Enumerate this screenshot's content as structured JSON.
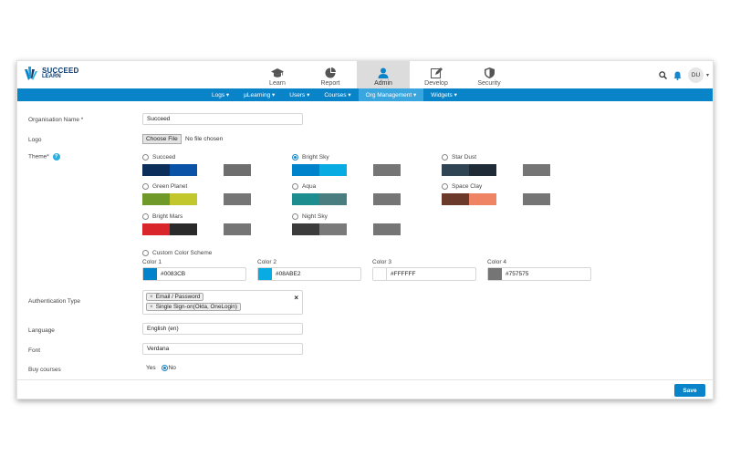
{
  "brand": {
    "line1": "SUCCEED",
    "line2": "LEARN"
  },
  "main_nav": [
    {
      "label": "Learn",
      "icon": "graduation-cap-icon",
      "active": false
    },
    {
      "label": "Report",
      "icon": "pie-chart-icon",
      "active": false
    },
    {
      "label": "Admin",
      "icon": "user-icon",
      "active": true
    },
    {
      "label": "Develop",
      "icon": "edit-icon",
      "active": false
    },
    {
      "label": "Security",
      "icon": "shield-icon",
      "active": false
    }
  ],
  "user": {
    "initials": "DU"
  },
  "sub_nav": [
    {
      "label": "Logs ▾",
      "active": false
    },
    {
      "label": "µLearning ▾",
      "active": false
    },
    {
      "label": "Users ▾",
      "active": false
    },
    {
      "label": "Courses ▾",
      "active": false
    },
    {
      "label": "Org Management ▾",
      "active": true
    },
    {
      "label": "Widgets ▾",
      "active": false
    }
  ],
  "form": {
    "org_name_label": "Organisation Name *",
    "org_name_value": "Succeed",
    "logo_label": "Logo",
    "file_button": "Choose File",
    "file_status": "No file chosen",
    "theme_label": "Theme*",
    "help_glyph": "?",
    "themes": [
      {
        "name": "Succeed",
        "selected": false,
        "colors": [
          "#0b2f5a",
          "#0a53a6",
          "#ffffff",
          "#6e6e6e"
        ]
      },
      {
        "name": "Bright Sky",
        "selected": true,
        "colors": [
          "#0083CB",
          "#08ABE2",
          "#ffffff",
          "#757575"
        ]
      },
      {
        "name": "Star Dust",
        "selected": false,
        "colors": [
          "#2f4554",
          "#1f2b36",
          "#ffffff",
          "#757575"
        ]
      },
      {
        "name": "Green Planet",
        "selected": false,
        "colors": [
          "#6f9a2a",
          "#c2c72e",
          "#ffffff",
          "#757575"
        ]
      },
      {
        "name": "Aqua",
        "selected": false,
        "colors": [
          "#1e8d8f",
          "#4a7d80",
          "#ffffff",
          "#757575"
        ]
      },
      {
        "name": "Space Clay",
        "selected": false,
        "colors": [
          "#6b3a2a",
          "#ef8464",
          "#ffffff",
          "#757575"
        ]
      },
      {
        "name": "Bright Mars",
        "selected": false,
        "colors": [
          "#d9262a",
          "#2a2a2a",
          "#ffffff",
          "#757575"
        ]
      },
      {
        "name": "Night Sky",
        "selected": false,
        "colors": [
          "#3c3c3c",
          "#7a7a7a",
          "#ffffff",
          "#757575"
        ]
      }
    ],
    "custom_scheme_label": "Custom Color Scheme",
    "custom_colors": [
      {
        "label": "Color 1",
        "hex": "#0083CB"
      },
      {
        "label": "Color 2",
        "hex": "#08ABE2"
      },
      {
        "label": "Color 3",
        "hex": "#FFFFFF"
      },
      {
        "label": "Color 4",
        "hex": "#757575"
      }
    ],
    "auth_label": "Authentication Type",
    "auth_tags": [
      "Email / Password",
      "Single Sign-on(Okta, OneLogin)"
    ],
    "tag_remove_glyph": "×",
    "clear_glyph": "×",
    "language_label": "Language",
    "language_value": "English (en)",
    "font_label": "Font",
    "font_value": "Verdana",
    "buy_label": "Buy courses",
    "buy_yes": "Yes",
    "buy_no": "No",
    "buy_selected": "No",
    "save_label": "Save"
  },
  "colors": {
    "primary": "#0a84c8",
    "subnav_active": "#3aa6e0",
    "brand_dark": "#0d3b6e"
  }
}
